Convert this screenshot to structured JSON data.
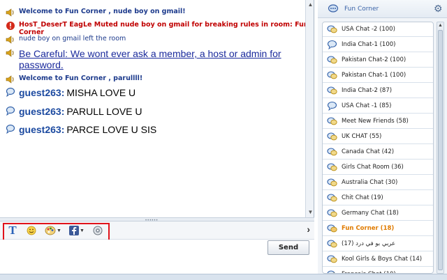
{
  "chat": {
    "messages": [
      {
        "kind": "system",
        "icon": "speaker-icon",
        "text": "Welcome to Fun Corner , nude boy on gmail!"
      },
      {
        "kind": "alert",
        "icon": "warning-icon",
        "text": "HosT_DeserT EagLe Muted nude boy on gmail for breaking rules in room: Fun Corner"
      },
      {
        "kind": "notice",
        "icon": "speaker-icon",
        "text": "nude boy on gmail left the room"
      },
      {
        "kind": "care",
        "icon": "speaker-icon",
        "text": "Be Careful: We wont ever ask a member, a host or admin for password."
      },
      {
        "kind": "system",
        "icon": "speaker-icon",
        "text": "Welcome to Fun Corner , parullll!"
      },
      {
        "kind": "user",
        "icon": "chat-bubble-icon",
        "user": "guest263:",
        "text": "MISHA LOVE U"
      },
      {
        "kind": "user",
        "icon": "chat-bubble-icon",
        "user": "guest263:",
        "text": "PARULL LOVE U"
      },
      {
        "kind": "user",
        "icon": "chat-bubble-icon",
        "user": "guest263:",
        "text": "PARCE LOVE U SIS"
      }
    ]
  },
  "toolbar": {
    "text_format_icon": "T",
    "send_label": "Send"
  },
  "rooms": {
    "title": "Fun Corner",
    "items": [
      {
        "label": "USA Chat -2  (100)",
        "active": false
      },
      {
        "label": "India Chat-1 (100)",
        "active": false
      },
      {
        "label": "Pakistan Chat-2 (100)",
        "active": false
      },
      {
        "label": "Pakistan Chat-1 (100)",
        "active": false
      },
      {
        "label": "India Chat-2 (87)",
        "active": false
      },
      {
        "label": "USA Chat -1 (85)",
        "active": false
      },
      {
        "label": "Meet New Friends  (58)",
        "active": false
      },
      {
        "label": "UK CHAT (55)",
        "active": false
      },
      {
        "label": "Canada Chat (42)",
        "active": false
      },
      {
        "label": "Girls Chat Room (36)",
        "active": false
      },
      {
        "label": "Australia Chat (30)",
        "active": false
      },
      {
        "label": "Chit Chat (19)",
        "active": false
      },
      {
        "label": "Germany Chat (18)",
        "active": false
      },
      {
        "label": "Fun Corner (18)",
        "active": true
      },
      {
        "label": "ﻋﺮﺑﻲ ﺑﻮ ﻓﻲ ﺩﺭﺩ (17)",
        "active": false
      },
      {
        "label": "Kool Girls & Boys Chat (14)",
        "active": false
      },
      {
        "label": "Francais Chat (10)",
        "active": false
      }
    ]
  },
  "colors": {
    "accent": "#3a63a8",
    "alert": "#c00000",
    "active_room": "#e07b00",
    "highlight_box": "#e0121b"
  }
}
